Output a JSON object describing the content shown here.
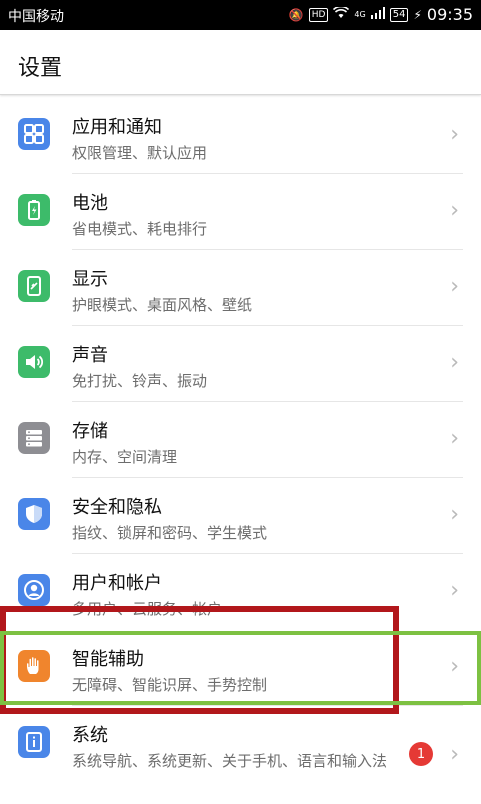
{
  "statusbar": {
    "carrier": "中国移动",
    "hd": "HD",
    "network": "4G",
    "battery": "54",
    "time": "09:35"
  },
  "header": {
    "title": "设置"
  },
  "items": [
    {
      "title": "应用和通知",
      "subtitle": "权限管理、默认应用",
      "icon": "apps-icon",
      "color": "#4a86e8"
    },
    {
      "title": "电池",
      "subtitle": "省电模式、耗电排行",
      "icon": "battery-icon",
      "color": "#3dbb6a"
    },
    {
      "title": "显示",
      "subtitle": "护眼模式、桌面风格、壁纸",
      "icon": "display-icon",
      "color": "#3dbb6a"
    },
    {
      "title": "声音",
      "subtitle": "免打扰、铃声、振动",
      "icon": "speaker-icon",
      "color": "#3dbb6a"
    },
    {
      "title": "存储",
      "subtitle": "内存、空间清理",
      "icon": "storage-icon",
      "color": "#8e8e93"
    },
    {
      "title": "安全和隐私",
      "subtitle": "指纹、锁屏和密码、学生模式",
      "icon": "shield-icon",
      "color": "#4a86e8"
    },
    {
      "title": "用户和帐户",
      "subtitle": "多用户、云服务、帐户",
      "icon": "user-icon",
      "color": "#4a86e8"
    },
    {
      "title": "智能辅助",
      "subtitle": "无障碍、智能识屏、手势控制",
      "icon": "hand-icon",
      "color": "#f0852d"
    },
    {
      "title": "系统",
      "subtitle": "系统导航、系统更新、关于手机、语言和输入法",
      "icon": "info-icon",
      "color": "#4a86e8",
      "badge": "1"
    }
  ],
  "chevron": "›",
  "annotations": {
    "red_box_color": "#b2171b",
    "green_box_color": "#7dc142"
  }
}
